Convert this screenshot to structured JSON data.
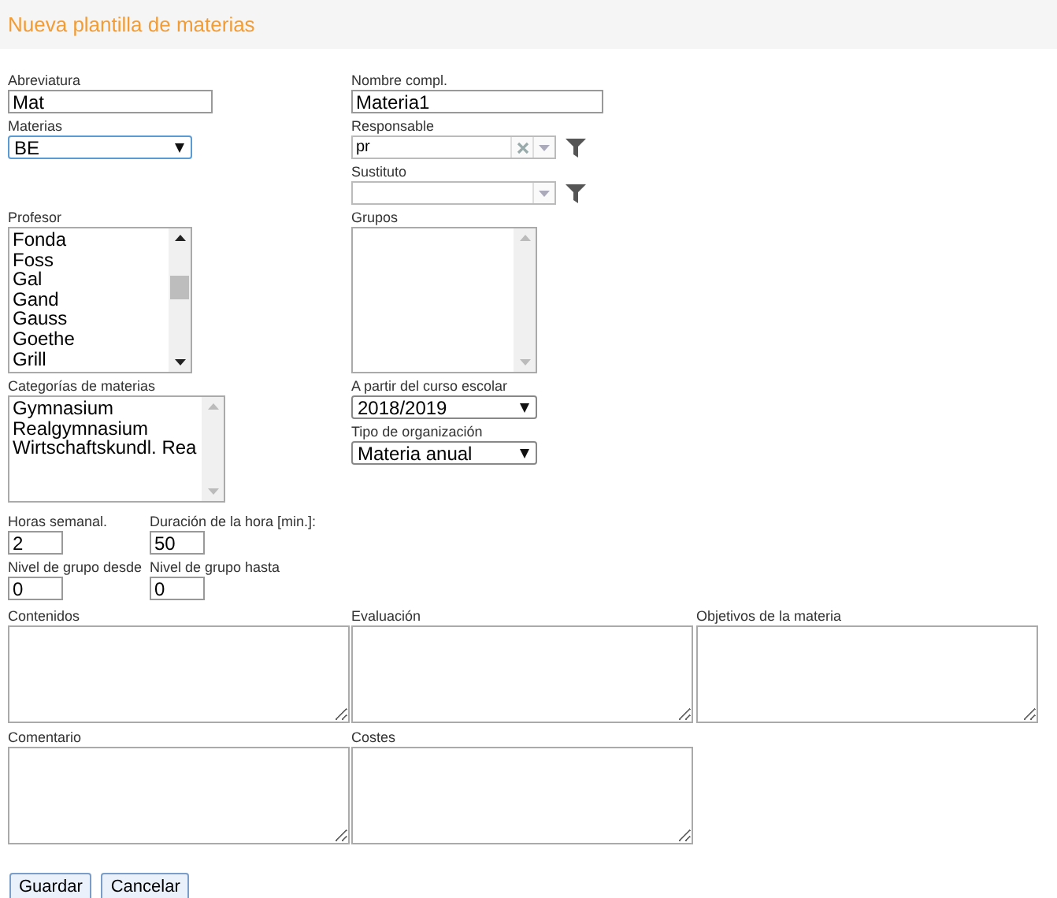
{
  "header": {
    "title": "Nueva plantilla de materias"
  },
  "abreviatura": {
    "label": "Abreviatura",
    "value": "Mat"
  },
  "nombre": {
    "label": "Nombre compl.",
    "value": "Materia1"
  },
  "materias": {
    "label": "Materias",
    "value": "BE"
  },
  "responsable": {
    "label": "Responsable",
    "value": "pr"
  },
  "sustituto": {
    "label": "Sustituto"
  },
  "profesor": {
    "label": "Profesor",
    "items": [
      "Fonda",
      "Foss",
      "Gal",
      "Gand",
      "Gauss",
      "Goethe",
      "Grill"
    ]
  },
  "grupos": {
    "label": "Grupos"
  },
  "categorias": {
    "label": "Categorías de materias",
    "items": [
      "Gymnasium",
      "Realgymnasium",
      "Wirtschaftskundl. Rea"
    ]
  },
  "curso": {
    "label": "A partir del curso escolar",
    "value": "2018/2019"
  },
  "tipo": {
    "label": "Tipo de organización",
    "value": "Materia anual"
  },
  "small_fields": [
    {
      "label": "Horas semanal.",
      "value": "2"
    },
    {
      "label": "Duración de la hora [min.]:",
      "value": "50"
    },
    {
      "label": "Nivel de grupo desde",
      "value": "0"
    },
    {
      "label": "Nivel de grupo hasta",
      "value": "0"
    }
  ],
  "text_areas": [
    {
      "label": "Contenidos"
    },
    {
      "label": "Evaluación"
    },
    {
      "label": "Objetivos de la materia"
    },
    {
      "label": "Comentario"
    },
    {
      "label": "Costes"
    }
  ],
  "buttons": [
    "Guardar",
    "Cancelar"
  ]
}
